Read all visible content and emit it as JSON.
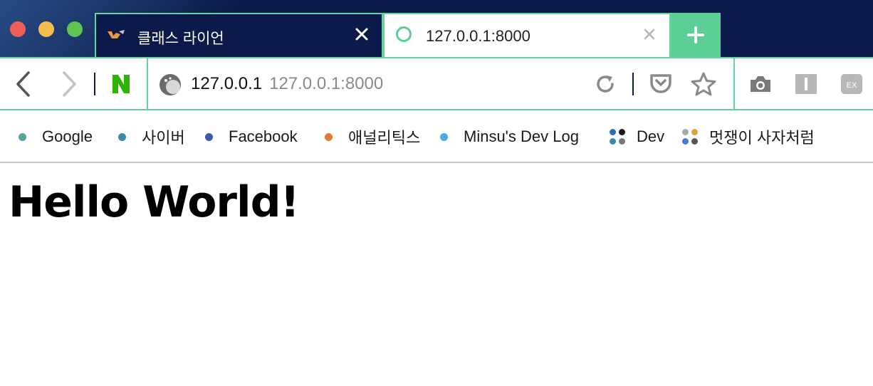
{
  "tabs": [
    {
      "title": "클래스 라이언",
      "active": false
    },
    {
      "title": "127.0.0.1:8000",
      "active": true
    }
  ],
  "toolbar": {
    "url_host": "127.0.0.1",
    "url_full": "127.0.0.1:8000"
  },
  "bookmarks": [
    {
      "label": "Google",
      "color": "#5aa39c"
    },
    {
      "label": "사이버",
      "color": "#3d8aa8"
    },
    {
      "label": "Facebook",
      "color": "#3f5aa8"
    },
    {
      "label": "애널리틱스",
      "color": "#e07b35"
    },
    {
      "label": "Minsu's Dev Log",
      "color": "#4fa8e0"
    },
    {
      "label": "Dev",
      "folder_colors": [
        "#2f6fb5",
        "#1a1a1a",
        "#3d8aa8",
        "#777777"
      ]
    },
    {
      "label": "멋쟁이 사자처럼",
      "folder_colors": [
        "#aaaaaa",
        "#e0a040",
        "#4a7ad0",
        "#555555"
      ]
    }
  ],
  "page": {
    "heading": "Hello World!"
  },
  "colors": {
    "accent": "#5ccf97",
    "tabbar_bg": "#0b1a4a"
  }
}
